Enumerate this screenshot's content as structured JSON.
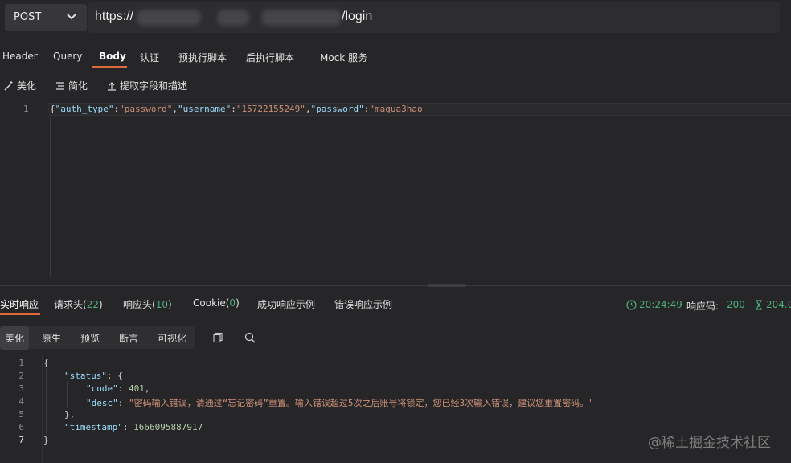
{
  "request": {
    "method": "POST",
    "url_prefix": "https://",
    "url_suffix": "/login"
  },
  "request_tabs": [
    "Header",
    "Query",
    "Body",
    "认证",
    "预执行脚本",
    "后执行脚本",
    "Mock 服务"
  ],
  "active_request_tab": "Body",
  "body_tools": {
    "beautify": "美化",
    "simplify": "简化",
    "extract": "提取字段和描述"
  },
  "request_body": {
    "line_number": "1",
    "tokens": [
      {
        "t": "{",
        "c": "p"
      },
      {
        "t": "\"auth_type\"",
        "c": "k"
      },
      {
        "t": ":",
        "c": "p"
      },
      {
        "t": "\"password\"",
        "c": "s"
      },
      {
        "t": ",",
        "c": "p"
      },
      {
        "t": "\"username\"",
        "c": "k"
      },
      {
        "t": ":",
        "c": "p"
      },
      {
        "t": "\"15722155249\"",
        "c": "s"
      },
      {
        "t": ",",
        "c": "p"
      },
      {
        "t": "\"password\"",
        "c": "k"
      },
      {
        "t": ":",
        "c": "p"
      },
      {
        "t": "\"magua3hao",
        "c": "s"
      }
    ]
  },
  "response_tabs": {
    "realtime": "实时响应",
    "req_headers": "请求头(",
    "req_headers_count": "22",
    "res_headers": "响应头(",
    "res_headers_count": "10",
    "cookie": "Cookie(",
    "cookie_count": "0",
    "close_paren": ")",
    "success_example": "成功响应示例",
    "error_example": "错误响应示例"
  },
  "response_meta": {
    "time": "20:24:49",
    "status_label": "响应码:",
    "status_code": "200",
    "duration": "204.0"
  },
  "view_buttons": [
    "美化",
    "原生",
    "预览",
    "断言",
    "可视化"
  ],
  "response_body": {
    "line_numbers": [
      "1",
      "2",
      "3",
      "4",
      "5",
      "6",
      "7"
    ],
    "open_brace": "{",
    "status_key": "\"status\"",
    "colon_brace": ": {",
    "code_key": "\"code\"",
    "code_val": "401",
    "desc_key": "\"desc\"",
    "desc_val": "\"密码输入错误，请通过“忘记密码”重置。输入错误超过5次之后账号将锁定，您已经3次输入错误，建议您重置密码。\"",
    "close_inner": "},",
    "timestamp_key": "\"timestamp\"",
    "timestamp_val": "1666095887917",
    "close_brace": "}",
    "comma": ",",
    "colon": ": "
  },
  "watermark": "@稀土掘金技术社区",
  "colors": {
    "accent": "#e06a3c",
    "green": "#4caf78",
    "key": "#9cdcfe",
    "string": "#ce9178"
  }
}
